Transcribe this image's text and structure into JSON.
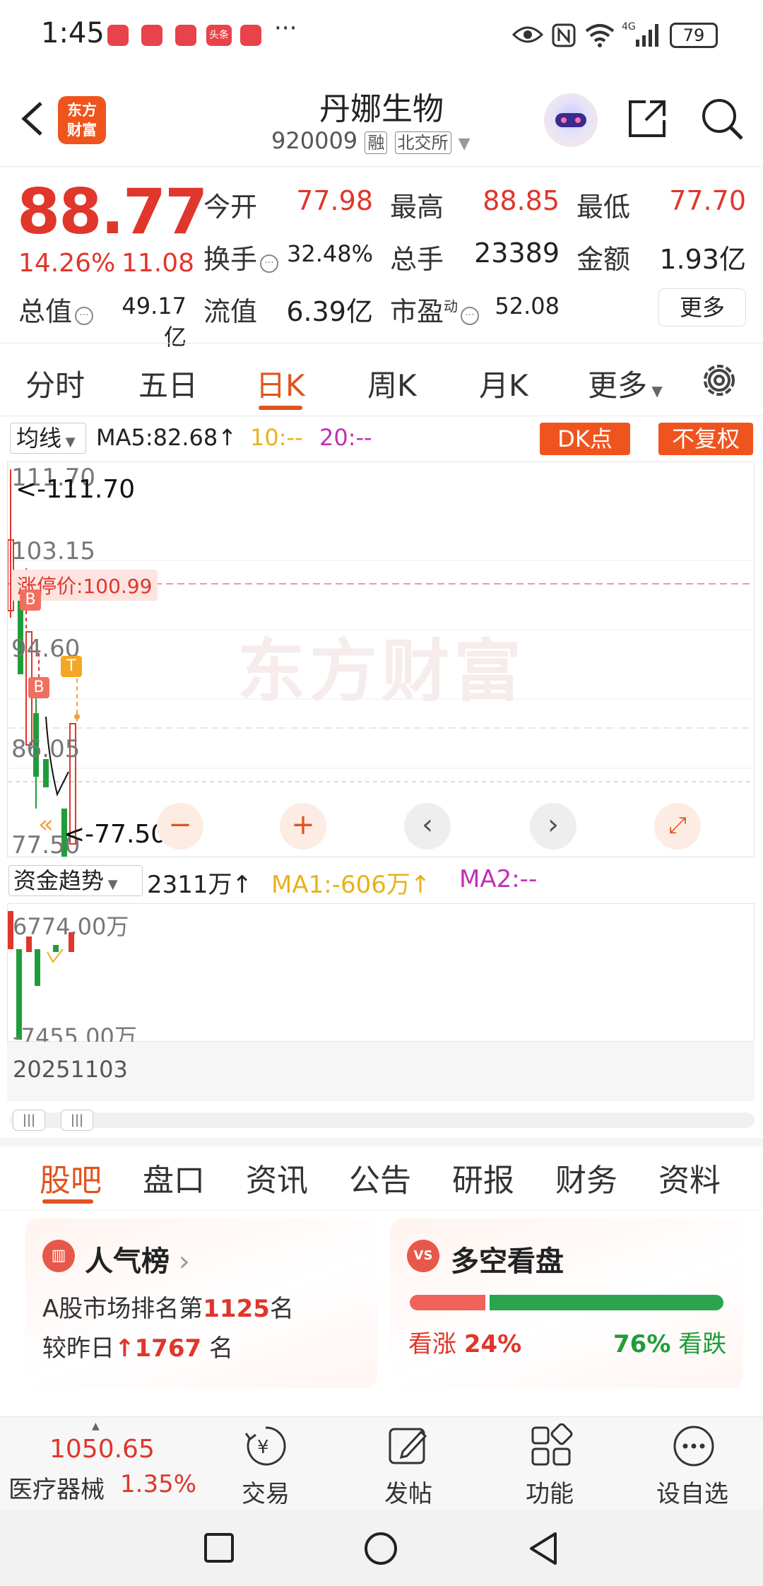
{
  "status_bar": {
    "time": "1:45",
    "more": "···",
    "battery": "79",
    "notification_icons": [
      "app-notification-icon",
      "app-notification-icon",
      "app-notification-icon",
      "toutiao-icon",
      "heart-app-icon"
    ],
    "right_icons": [
      "eye-icon",
      "nfc-icon",
      "wifi-icon",
      "signal-4g-icon",
      "battery-icon"
    ]
  },
  "header": {
    "logo_line1": "东方",
    "logo_line2": "财富",
    "stock_name": "丹娜生物",
    "stock_code": "920009",
    "tag_margin": "融",
    "tag_exchange": "北交所"
  },
  "quote": {
    "price": "88.77",
    "change_pct": "14.26%",
    "change_abs": "11.08",
    "open_label": "今开",
    "open_value": "77.98",
    "high_label": "最高",
    "high_value": "88.85",
    "low_label": "最低",
    "low_value": "77.70",
    "turnover_label": "换手",
    "turnover_value": "32.48%",
    "volume_label": "总手",
    "volume_value": "23389",
    "amount_label": "金额",
    "amount_value": "1.93亿",
    "mcap_label": "总值",
    "mcap_value": "49.17亿",
    "float_label": "流值",
    "float_value": "6.39亿",
    "pe_label": "市盈",
    "pe_sup": "动",
    "pe_value": "52.08",
    "more_button": "更多"
  },
  "chart_tabs": [
    "分时",
    "五日",
    "日K",
    "周K",
    "月K",
    "更多"
  ],
  "ma_bar": {
    "select": "均线",
    "ma5": "MA5:82.68",
    "ma10": "10:--",
    "ma20": "20:--",
    "dk_button": "DK点",
    "fq_button": "不复权"
  },
  "kline": {
    "y_ticks": [
      "111.70",
      "103.15",
      "94.60",
      "86.05",
      "77.50"
    ],
    "max_label": "<-111.70",
    "min_label": "<-77.50",
    "limit_label": "涨停价:100.99",
    "watermark": "东方财富",
    "markers": [
      "B",
      "B",
      "T"
    ],
    "colors": {
      "up": "#e0362b",
      "down": "#1f9d3a",
      "limit_line": "#e0362b"
    }
  },
  "flow": {
    "select": "资金趋势",
    "value": "2311万",
    "ma1": "MA1:-606万",
    "ma2": "MA2:--",
    "max": "6774.00万",
    "min": "-7455.00万",
    "date": "20251103"
  },
  "bottom_tabs": [
    "股吧",
    "盘口",
    "资讯",
    "公告",
    "研报",
    "财务",
    "资料"
  ],
  "popularity_card": {
    "title": "人气榜",
    "line1_prefix": "A股市场排名第",
    "rank": "1125",
    "line1_suffix": "名",
    "line2_prefix": "较昨日",
    "rank_change": "1767",
    "line2_suffix": " 名"
  },
  "long_short_card": {
    "title": "多空看盘",
    "up_label": "看涨",
    "up_pct": "24%",
    "down_pct": "76%",
    "down_label": "看跌",
    "up_fraction": 0.24
  },
  "toolbar": {
    "index_value": "1050.65",
    "index_name": "医疗器械",
    "index_pct": "1.35%",
    "items": [
      "交易",
      "发帖",
      "功能",
      "设自选"
    ]
  }
}
